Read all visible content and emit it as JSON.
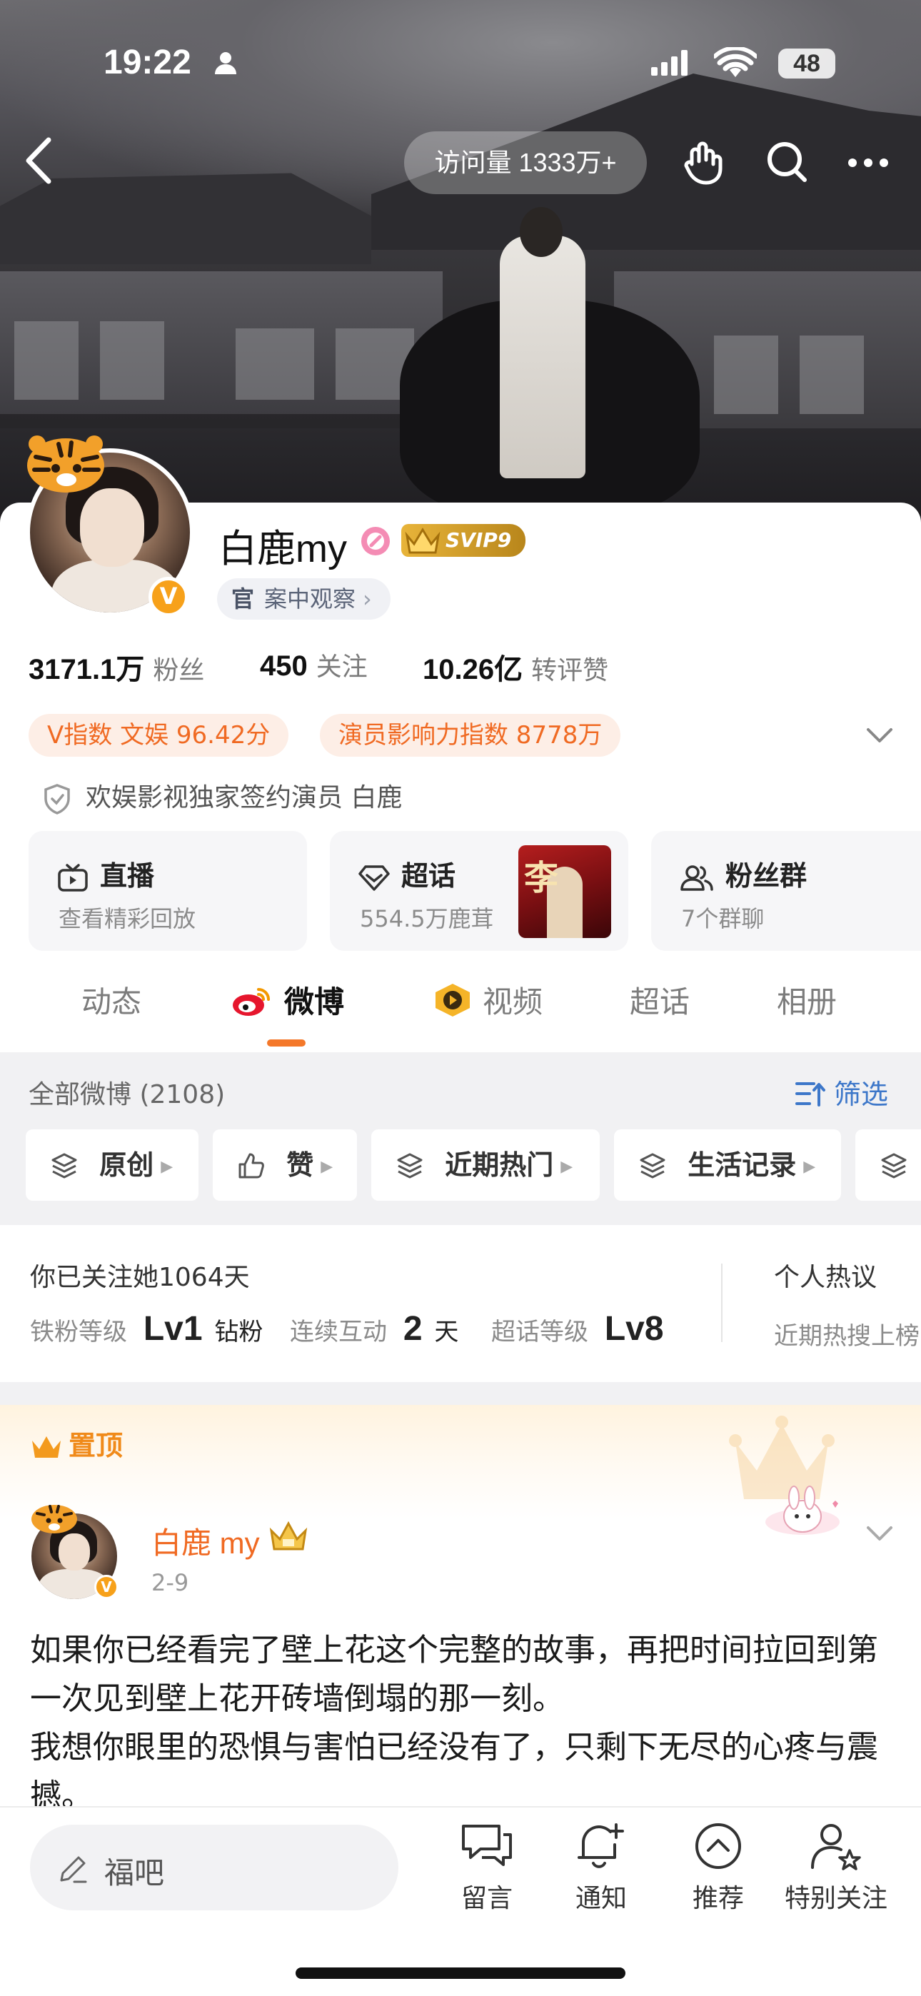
{
  "status_bar": {
    "time": "19:22",
    "battery": "48"
  },
  "header": {
    "visit_count": "访问量 1333万+"
  },
  "profile": {
    "name": "白鹿my",
    "svip": "SVIP9",
    "tag": {
      "prefix": "官",
      "label": "案中观察"
    },
    "stats": [
      {
        "value": "3171.1万",
        "label": "粉丝"
      },
      {
        "value": "450",
        "label": "关注"
      },
      {
        "value": "10.26亿",
        "label": "转评赞"
      }
    ],
    "chips": [
      {
        "label": "V指数 文娱 96.42分"
      },
      {
        "label": "演员影响力指数 8778万"
      }
    ],
    "certification": "欢娱影视独家签约演员 白鹿",
    "tiles": [
      {
        "title": "直播",
        "subtitle": "查看精彩回放"
      },
      {
        "title": "超话",
        "subtitle": "554.5万鹿茸"
      },
      {
        "title": "粉丝群",
        "subtitle": "7个群聊"
      }
    ]
  },
  "tabs": [
    {
      "label": "动态"
    },
    {
      "label": "微博"
    },
    {
      "label": "视频"
    },
    {
      "label": "超话"
    },
    {
      "label": "相册"
    }
  ],
  "filter": {
    "all_posts": "全部微博 (2108)",
    "filter_label": "筛选",
    "chips": [
      "原创",
      "赞",
      "近期热门",
      "生活记录"
    ]
  },
  "fan_info": {
    "follow_days": "你已关注她1064天",
    "iron_label": "铁粉等级",
    "iron_value": "Lv1",
    "iron_unit": "钻粉",
    "streak_label": "连续互动",
    "streak_value": "2",
    "streak_unit": "天",
    "topic_label": "超话等级",
    "topic_value": "Lv8",
    "hot_title": "个人热议",
    "hot_sub": "近期热搜上榜"
  },
  "pinned": {
    "label": "置顶",
    "author": "白鹿 my",
    "date": "2-9",
    "text": "如果你已经看完了壁上花这个完整的故事，再把时间拉回到第一次见到壁上花开砖墙倒塌的那一刻。\n我想你眼里的恐惧与害怕已经没有了，只剩下无尽的心疼与震撼。"
  },
  "bottom_bar": {
    "comment_placeholder": "福吧",
    "nav": [
      {
        "label": "留言",
        "icon": "message-icon"
      },
      {
        "label": "通知",
        "icon": "bell-icon"
      },
      {
        "label": "推荐",
        "icon": "recommend-icon"
      },
      {
        "label": "特别关注",
        "icon": "special-follow-icon"
      }
    ]
  },
  "colors": {
    "accent": "#f06a23",
    "link": "#3d77c9",
    "gold": "#e8b43a"
  }
}
